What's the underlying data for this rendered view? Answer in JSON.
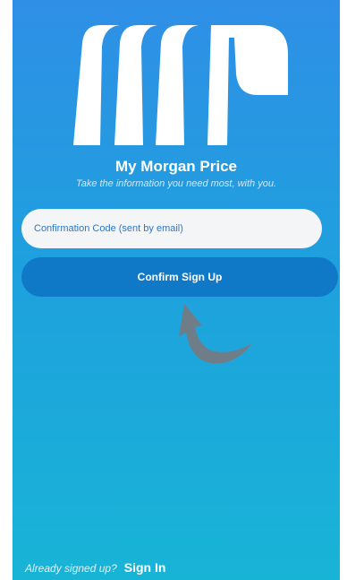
{
  "app": {
    "title": "My Morgan Price",
    "tagline": "Take the information you need most, with you."
  },
  "form": {
    "code_placeholder": "Confirmation Code (sent by email)",
    "confirm_label": "Confirm Sign Up"
  },
  "footer": {
    "already_text": "Already signed up?",
    "sign_in_label": "Sign In"
  },
  "icons": {
    "logo": "mp-logo",
    "arrow": "curved-arrow-icon"
  },
  "colors": {
    "gradient_top": "#2f8fe6",
    "gradient_bottom": "#18b4d6",
    "button": "#0f79c7",
    "input_bg": "#f4f5f7",
    "input_text": "#2d77c8",
    "arrow": "#6f7d88"
  }
}
